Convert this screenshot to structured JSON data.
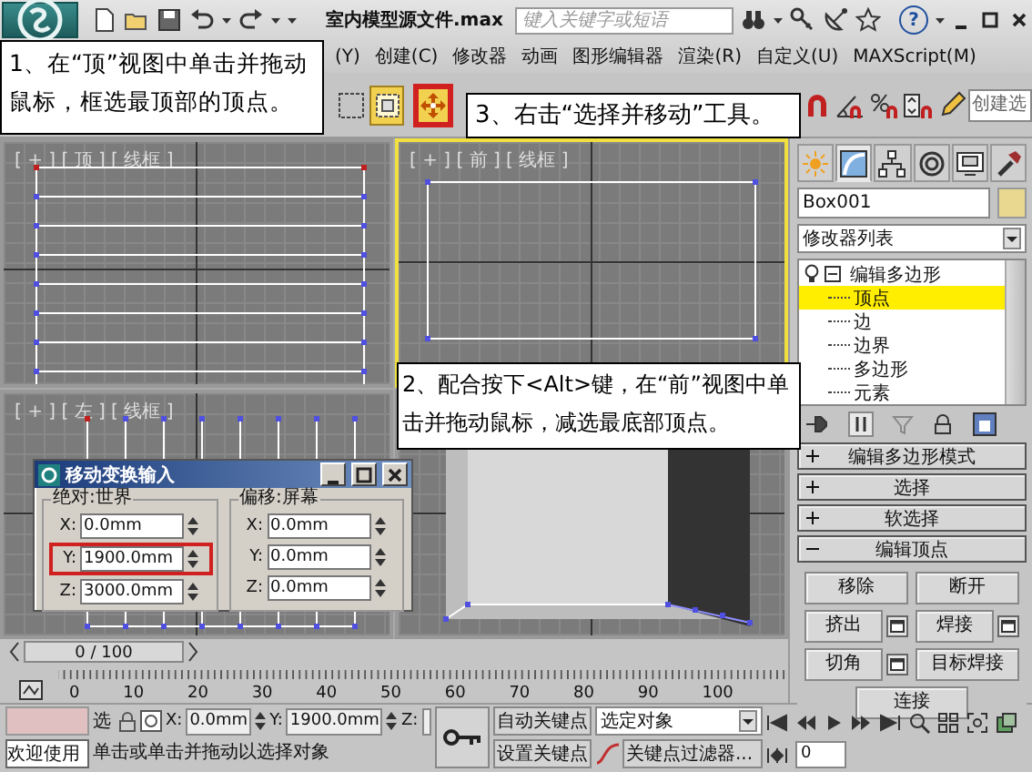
{
  "app": {
    "title": "室内模型源文件.max",
    "search": {
      "placeholder": "键入关键字或短语"
    },
    "help": "?"
  },
  "menu": [
    {
      "label": "(Y)"
    },
    {
      "label": "创建(C)"
    },
    {
      "label": "修改器"
    },
    {
      "label": "动画"
    },
    {
      "label": "图形编辑器"
    },
    {
      "label": "渲染(R)"
    },
    {
      "label": "自定义(U)"
    },
    {
      "label": "MAXScript(M)"
    }
  ],
  "toolbar": {
    "tools": [
      {
        "kind": "window",
        "selected": false,
        "marked": false
      },
      {
        "kind": "region",
        "selected": true,
        "marked": false
      },
      {
        "kind": "move",
        "selected": true,
        "marked": true
      }
    ],
    "named_selection": "创建选"
  },
  "viewports": [
    {
      "kind": "top",
      "label": "[ + ] [ 顶 ] [ 线框 ]",
      "active": false
    },
    {
      "kind": "front",
      "label": "[ + ] [ 前 ] [ 线框 ]",
      "active": true
    },
    {
      "kind": "left",
      "label": "[ + ] [ 左 ] [ 线框 ]",
      "active": false
    },
    {
      "kind": "perspective",
      "active": false
    }
  ],
  "annotations": [
    {
      "text": "1、在“顶”视图中单击并拖动鼠标，框选最顶部的顶点。"
    },
    {
      "text": "3、右击“选择并移动”工具。"
    },
    {
      "text": "2、配合按下<Alt>键，在“前”视图中单击并拖动鼠标，减选最底部顶点。"
    }
  ],
  "dialog": {
    "title": "移动变换输入",
    "groups": [
      {
        "title": "绝对:世界",
        "fields": [
          {
            "label": "X:",
            "value": "0.0mm",
            "marked": false
          },
          {
            "label": "Y:",
            "value": "1900.0mm",
            "marked": true
          },
          {
            "label": "Z:",
            "value": "3000.0mm",
            "marked": false
          }
        ]
      },
      {
        "title": "偏移:屏幕",
        "fields": [
          {
            "label": "X:",
            "value": "0.0mm",
            "marked": false
          },
          {
            "label": "Y:",
            "value": "0.0mm",
            "marked": false
          },
          {
            "label": "Z:",
            "value": "0.0mm",
            "marked": false
          }
        ]
      }
    ]
  },
  "command_panel": {
    "tabs": [
      {
        "kind": "create",
        "selected": false
      },
      {
        "kind": "modify",
        "selected": true
      },
      {
        "kind": "hierarchy",
        "selected": false
      },
      {
        "kind": "motion",
        "selected": false
      },
      {
        "kind": "display",
        "selected": false
      },
      {
        "kind": "utilities",
        "selected": false
      }
    ],
    "object_name": "Box001",
    "modifier_list": "修改器列表",
    "stack": [
      {
        "label": "编辑多边形",
        "expanded": true,
        "selected": false,
        "children": [
          {
            "label": "顶点",
            "selected": true
          },
          {
            "label": "边",
            "selected": false
          },
          {
            "label": "边界",
            "selected": false
          },
          {
            "label": "多边形",
            "selected": false
          },
          {
            "label": "元素",
            "selected": false
          }
        ]
      }
    ],
    "rollouts": [
      {
        "label": "编辑多边形模式",
        "expanded": false
      },
      {
        "label": "选择",
        "expanded": false
      },
      {
        "label": "软选择",
        "expanded": false
      },
      {
        "label": "编辑顶点",
        "expanded": true
      }
    ],
    "vertex_buttons": [
      {
        "label": "移除",
        "settings": false
      },
      {
        "label": "断开",
        "settings": false
      },
      {
        "label": "挤出",
        "settings": true
      },
      {
        "label": "焊接",
        "settings": true
      },
      {
        "label": "切角",
        "settings": true
      },
      {
        "label": "目标焊接",
        "settings": false
      },
      {
        "label": "连接",
        "settings": false
      }
    ]
  },
  "timeline": {
    "position": "0 / 100",
    "ticks": [
      "0",
      "10",
      "20",
      "30",
      "40",
      "50",
      "60",
      "70",
      "80",
      "90",
      "100"
    ]
  },
  "status": {
    "message": "欢迎使用",
    "selection_label": "选",
    "coords": [
      {
        "label": "X:",
        "value": "0.0mm"
      },
      {
        "label": "Y:",
        "value": "1900.0mm"
      },
      {
        "label": "Z:"
      }
    ],
    "prompt": "单击或单击并拖动以选择对象",
    "auto_key": "自动关键点",
    "set_key": "设置关键点",
    "key_mode": "选定对象",
    "key_filters": "关键点过滤器...",
    "frame": "0"
  }
}
